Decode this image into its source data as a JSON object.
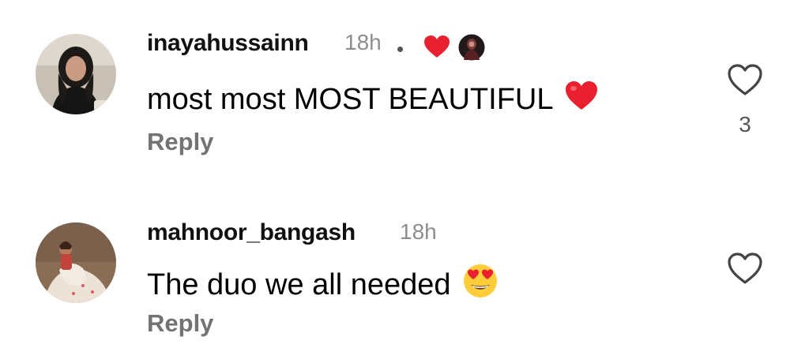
{
  "colors": {
    "username": "#111111",
    "timestamp": "#8e8e8e",
    "reply": "#737373",
    "heart_red": "#e8202f",
    "like_outline": "#444444"
  },
  "comments": [
    {
      "username": "inayahussainn",
      "time": "18h",
      "text": "most most MOST BEAUTIFUL",
      "text_emoji": "red-heart-emoji",
      "reply_label": "Reply",
      "like_count": "3",
      "creator_liked": true,
      "like_icon": "heart-outline-icon"
    },
    {
      "username": "mahnoor_bangash",
      "time": "18h",
      "text": "The duo we all needed",
      "text_emoji": "heart-eyes-emoji",
      "reply_label": "Reply",
      "like_count": "",
      "creator_liked": false,
      "like_icon": "heart-outline-icon"
    }
  ]
}
